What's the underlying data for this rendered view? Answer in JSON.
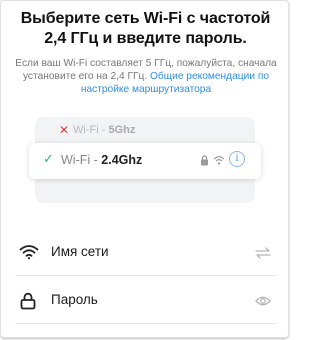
{
  "header": {
    "title": "Выберите сеть Wi-Fi с частотой 2,4 ГГц и введите пароль."
  },
  "description": {
    "text": "Если ваш Wi-Fi составляет 5 ГГц, пожалуйста, сначала установите его на 2,4 ГГц. ",
    "link": "Общие рекомендации по настройке маршрутизатора"
  },
  "illustration": {
    "bad_prefix": "Wi-Fi - ",
    "bad_band": "5Ghz",
    "good_prefix": "Wi-Fi - ",
    "good_band": "2.4Ghz",
    "info_glyph": "i"
  },
  "form": {
    "network_label": "Имя сети",
    "password_label": "Пароль"
  },
  "icons": {
    "wifi": "wifi-icon",
    "lock": "lock-icon",
    "switch": "swap-arrows-icon",
    "eye": "eye-icon",
    "check": "check-icon",
    "cross": "cross-icon"
  },
  "colors": {
    "link": "#2d8cf0",
    "check": "#2db36b",
    "cross": "#e03c3c"
  }
}
